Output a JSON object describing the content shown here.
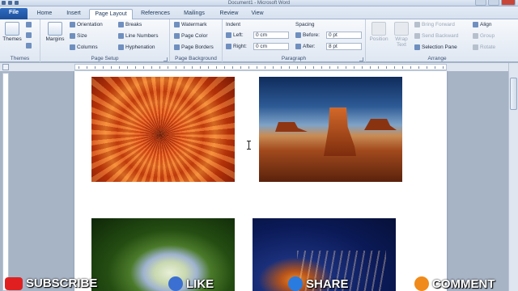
{
  "window": {
    "title": "Document1 - Microsoft Word"
  },
  "tabs": [
    "File",
    "Home",
    "Insert",
    "Page Layout",
    "References",
    "Mailings",
    "Review",
    "View"
  ],
  "active_tab": "Page Layout",
  "ribbon": {
    "themes": {
      "button": "Themes",
      "label": "Themes"
    },
    "page_setup": {
      "margins": "Margins",
      "orientation": "Orientation",
      "size": "Size",
      "columns": "Columns",
      "breaks": "Breaks",
      "line_numbers": "Line Numbers",
      "hyphenation": "Hyphenation",
      "label": "Page Setup"
    },
    "page_background": {
      "watermark": "Watermark",
      "page_color": "Page Color",
      "page_borders": "Page Borders",
      "label": "Page Background"
    },
    "paragraph": {
      "indent_title": "Indent",
      "left_label": "Left:",
      "left_value": "0 cm",
      "right_label": "Right:",
      "right_value": "0 cm",
      "spacing_title": "Spacing",
      "before_label": "Before:",
      "before_value": "0 pt",
      "after_label": "After:",
      "after_value": "8 pt",
      "label": "Paragraph"
    },
    "arrange": {
      "position": "Position",
      "wrap_text": "Wrap Text",
      "bring_forward": "Bring Forward",
      "send_backward": "Send Backward",
      "selection_pane": "Selection Pane",
      "align": "Align",
      "group": "Group",
      "rotate": "Rotate",
      "label": "Arrange"
    }
  },
  "images": [
    {
      "name": "flower-photo",
      "icon": "orange-chrysanthemum"
    },
    {
      "name": "desert-photo",
      "icon": "desert-butte"
    },
    {
      "name": "hydrangea-photo",
      "icon": "hydrangea"
    },
    {
      "name": "jellyfish-photo",
      "icon": "jellyfish"
    }
  ],
  "overlay": {
    "subscribe": "SUBSCRIBE",
    "like": "LIKE",
    "share": "SHARE",
    "comment": "COMMENT"
  },
  "colors": {
    "file_tab": "#2a62b5",
    "ribbon": "#e9eff7",
    "subscribe_badge": "#e02020",
    "like_badge": "#3b6fd1",
    "share_badge": "#2a7be0",
    "comment_badge": "#f08a1a"
  }
}
